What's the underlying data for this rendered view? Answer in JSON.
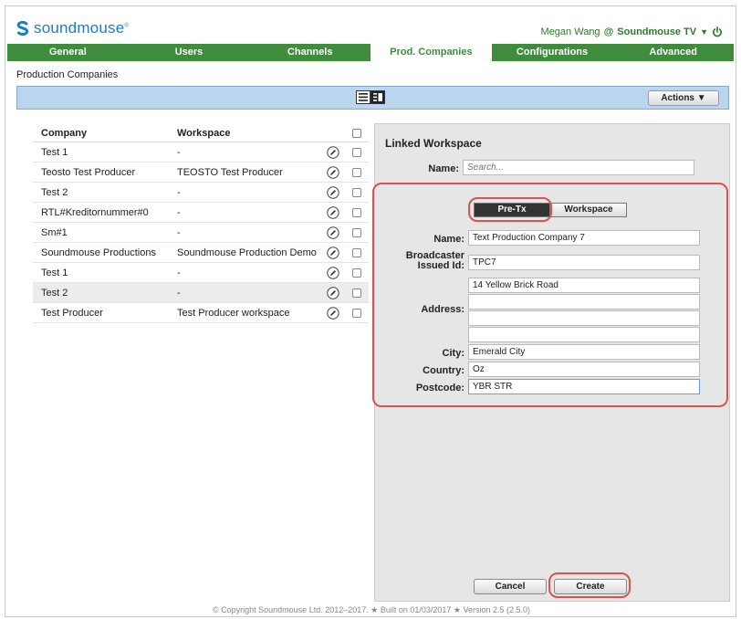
{
  "header": {
    "logo_text": "soundmouse",
    "logo_mark": "®",
    "user_name": "Megan Wang",
    "at": "@",
    "org": "Soundmouse TV",
    "dropdown_arrow": "▼"
  },
  "nav": {
    "tabs": [
      {
        "label": "General"
      },
      {
        "label": "Users"
      },
      {
        "label": "Channels"
      },
      {
        "label": "Prod. Companies"
      },
      {
        "label": "Configurations"
      },
      {
        "label": "Advanced"
      }
    ],
    "active": "Prod. Companies"
  },
  "breadcrumb": "Production Companies",
  "toolbar": {
    "actions_label": "Actions ▼"
  },
  "table": {
    "headers": {
      "company": "Company",
      "workspace": "Workspace"
    },
    "rows": [
      {
        "company": "Test 1",
        "workspace": "-"
      },
      {
        "company": "Teosto Test Producer",
        "workspace": "TEOSTO Test Producer"
      },
      {
        "company": "Test 2",
        "workspace": "-"
      },
      {
        "company": "RTL#Kreditornummer#0",
        "workspace": "-"
      },
      {
        "company": "Sm#1",
        "workspace": "-"
      },
      {
        "company": "Soundmouse Productions",
        "workspace": "Soundmouse Production Demo"
      },
      {
        "company": "Test 1",
        "workspace": "-"
      },
      {
        "company": "Test 2",
        "workspace": "-"
      },
      {
        "company": "Test Producer",
        "workspace": "Test Producer workspace"
      }
    ],
    "highlighted_row": 7
  },
  "panel": {
    "title": "Linked Workspace",
    "name_label": "Name:",
    "name_placeholder": "Search...",
    "toggle": {
      "pre_tx": "Pre-Tx",
      "workspace": "Workspace"
    },
    "form": {
      "name_label": "Name:",
      "name_value": "Text Production Company 7",
      "broadcaster_label_1": "Broadcaster",
      "broadcaster_label_2": "Issued Id:",
      "broadcaster_value": "TPC7",
      "address_label": "Address:",
      "address_lines": [
        "14 Yellow Brick Road",
        "",
        "",
        ""
      ],
      "city_label": "City:",
      "city_value": "Emerald City",
      "country_label": "Country:",
      "country_value": "Oz",
      "postcode_label": "Postcode:",
      "postcode_value": "YBR STR"
    },
    "cancel_label": "Cancel",
    "create_label": "Create"
  },
  "footer": "© Copyright Soundmouse Ltd. 2012–2017. ★ Built on 01/03/2017 ★ Version 2.5 (2.5.0)",
  "colors": {
    "brand_blue": "#1b7fc1",
    "nav_green": "#3f8d3c",
    "annotation_red": "#d9534f",
    "toolbar_blue": "#bcd5ee"
  }
}
